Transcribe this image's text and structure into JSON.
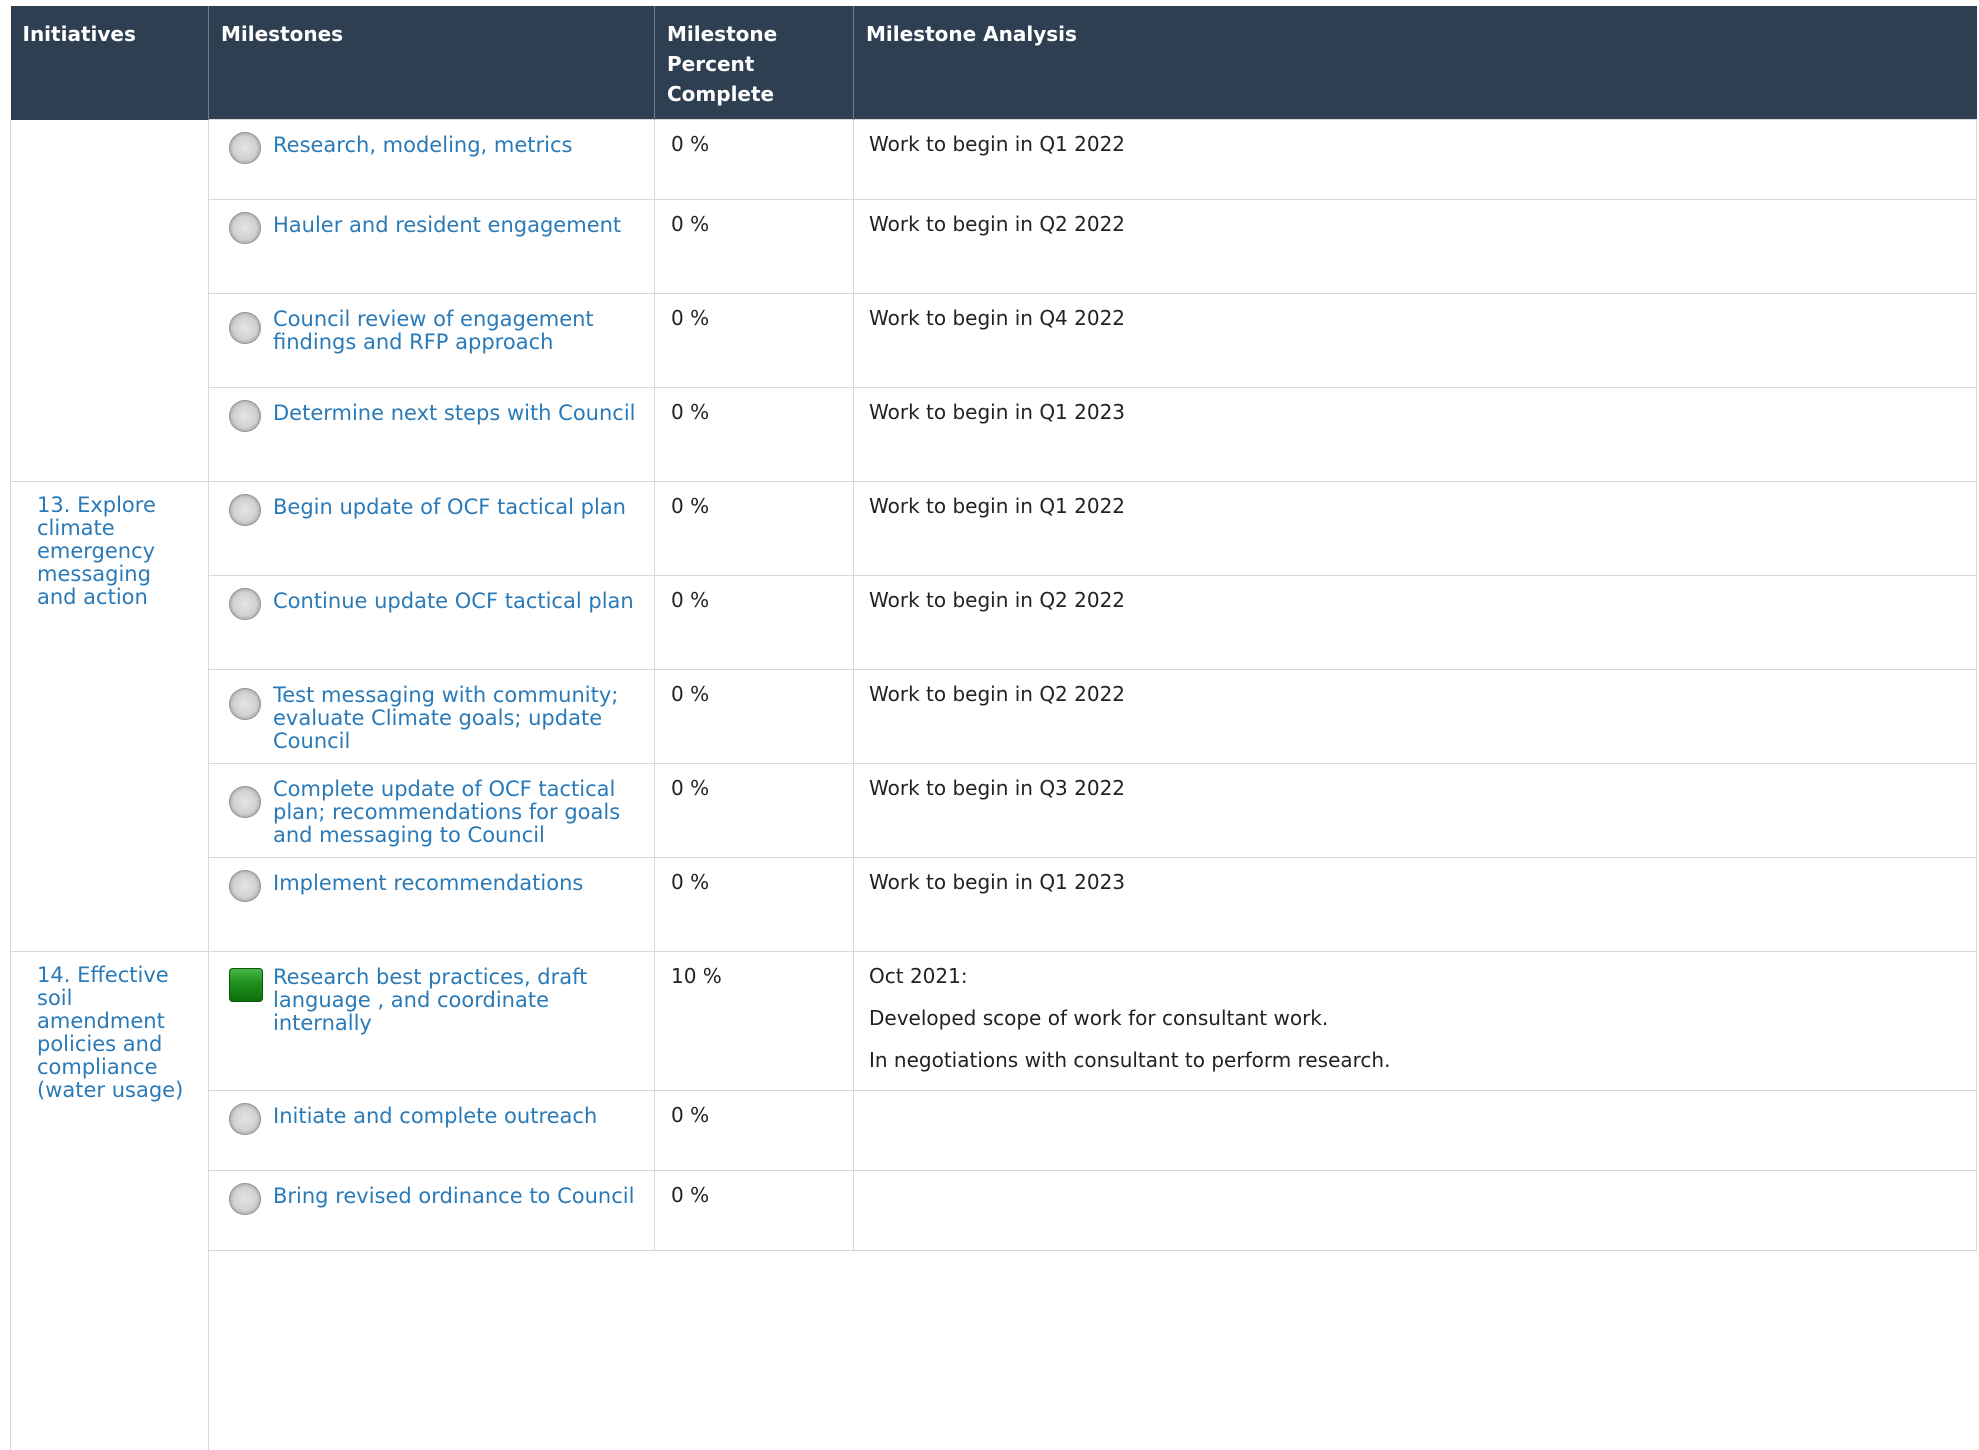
{
  "headers": {
    "initiatives": "Initiatives",
    "milestones": "Milestones",
    "percent_complete": "Milestone Percent Complete",
    "analysis": "Milestone Analysis"
  },
  "groups": [
    {
      "initiative": "",
      "milestones": [
        {
          "name": "Research, modeling, metrics",
          "status": "not-started",
          "percent": "0 %",
          "analysis": [
            "Work to begin in Q1 2022"
          ]
        },
        {
          "name": "Hauler and resident engagement",
          "status": "not-started",
          "percent": "0 %",
          "analysis": [
            "Work to begin in Q2 2022"
          ]
        },
        {
          "name": "Council review of engagement findings and RFP approach",
          "status": "not-started",
          "percent": "0 %",
          "analysis": [
            "Work to begin in Q4 2022"
          ]
        },
        {
          "name": "Determine next steps with Council",
          "status": "not-started",
          "percent": "0 %",
          "analysis": [
            "Work to begin in Q1 2023"
          ]
        }
      ]
    },
    {
      "initiative": "13. Explore climate emergency messaging and action",
      "milestones": [
        {
          "name": "Begin update of OCF tactical plan",
          "status": "not-started",
          "percent": "0 %",
          "analysis": [
            "Work to begin in Q1 2022"
          ]
        },
        {
          "name": "Continue update OCF tactical plan",
          "status": "not-started",
          "percent": "0 %",
          "analysis": [
            "Work to begin in Q2 2022"
          ]
        },
        {
          "name": "Test messaging with community; evaluate Climate goals; update Council",
          "status": "not-started",
          "percent": "0 %",
          "analysis": [
            "Work to begin in Q2 2022"
          ]
        },
        {
          "name": "Complete update of OCF tactical plan; recommendations for goals and messaging to Council",
          "status": "not-started",
          "percent": "0 %",
          "analysis": [
            "Work to begin in Q3 2022"
          ]
        },
        {
          "name": "Implement recommendations",
          "status": "not-started",
          "percent": "0 %",
          "analysis": [
            "Work to begin in Q1 2023"
          ]
        }
      ]
    },
    {
      "initiative": "14. Effective soil amendment policies and compliance (water usage)",
      "milestones": [
        {
          "name": "Research best practices, draft language , and coordinate internally",
          "status": "on-track",
          "percent": "10 %",
          "analysis": [
            "Oct 2021:",
            "Developed scope of work for consultant work.",
            "In negotiations with consultant to perform research."
          ]
        },
        {
          "name": "Initiate and complete outreach",
          "status": "not-started",
          "percent": "0 %",
          "analysis": []
        },
        {
          "name": "Bring revised ordinance to Council",
          "status": "not-started",
          "percent": "0 %",
          "analysis": []
        }
      ]
    }
  ],
  "colors": {
    "header_bg": "#2e3f51",
    "link": "#2a7ab8",
    "status_on_track": "#1e8f1c",
    "status_not_started": "#bdbdbd"
  }
}
